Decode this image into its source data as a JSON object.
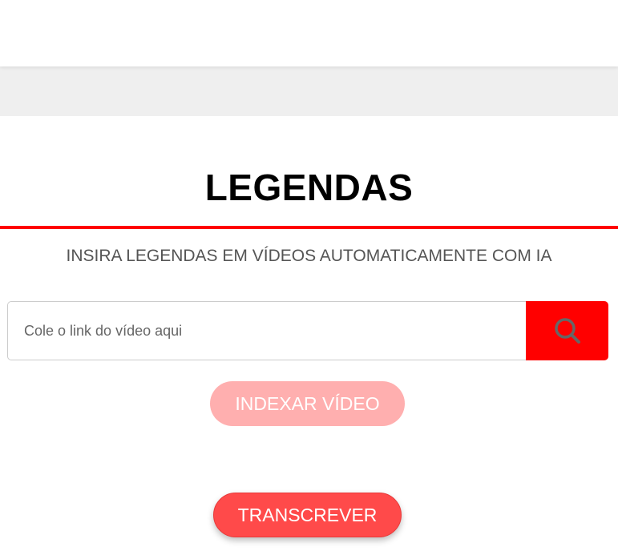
{
  "hero": {
    "title": "LEGENDAS",
    "subtitle": "INSIRA LEGENDAS EM VÍDEOS AUTOMATICAMENTE COM IA"
  },
  "search": {
    "value": "",
    "placeholder": "Cole o link do vídeo aqui",
    "button_icon": "search-icon"
  },
  "actions": {
    "index_label": "INDEXAR VÍDEO",
    "index_state": "disabled",
    "transcribe_label": "TRANSCREVER"
  },
  "colors": {
    "accent": "#ff0000",
    "accent_muted": "#ffafaf",
    "transcribe": "#ff4a4a",
    "icon_gray": "#666666"
  }
}
